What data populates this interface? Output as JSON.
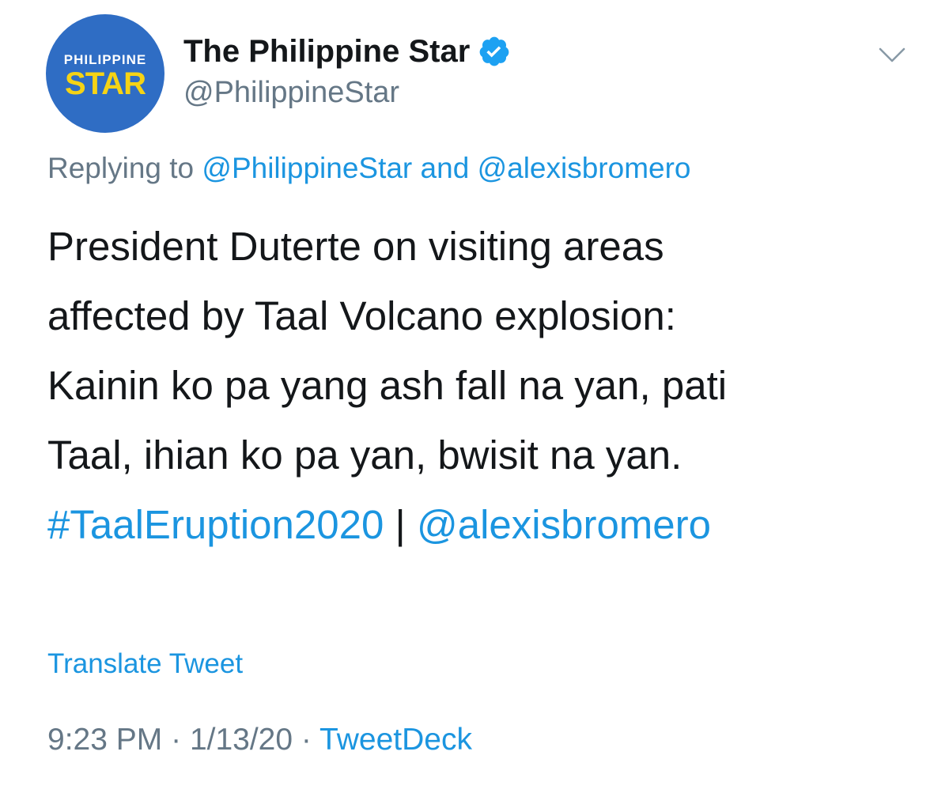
{
  "author": {
    "avatar_line1": "PHILIPPINE",
    "avatar_line2": "STAR",
    "display_name": "The Philippine Star",
    "handle": "@PhilippineStar",
    "verified_icon": "verified-badge"
  },
  "menu_icon": "chevron-down",
  "replying": {
    "prefix": "Replying to",
    "user1": "@PhilippineStar",
    "conjunction": "and",
    "user2": "@alexisbromero"
  },
  "tweet": {
    "lines": [
      "President Duterte on visiting areas",
      "affected by Taal Volcano explosion:",
      "Kainin ko pa yang ash fall na yan, pati",
      "Taal, ihian ko pa yan, bwisit na yan."
    ],
    "hashtag": "#TaalEruption2020",
    "separator": "|",
    "mention": "@alexisbromero"
  },
  "translate_label": "Translate Tweet",
  "meta": {
    "time": "9:23 PM",
    "dot1": "·",
    "date": "1/13/20",
    "dot2": "·",
    "source": "TweetDeck"
  },
  "colors": {
    "link": "#1b95e0",
    "muted": "#657786",
    "text": "#14171a",
    "avatar_bg": "#2f6dc4",
    "avatar_accent": "#f5d315"
  }
}
